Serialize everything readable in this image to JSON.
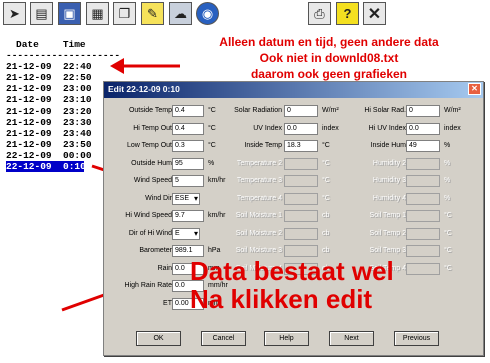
{
  "toolbar": {
    "left_icons": [
      "cursor-icon",
      "chart-icon",
      "image-icon",
      "grid-icon",
      "window-icon",
      "notes-icon",
      "cloud-icon",
      "noaa-icon"
    ],
    "right_icons": [
      "print-icon",
      "help-icon",
      "close-icon"
    ]
  },
  "list": {
    "col_date": "Date",
    "col_time": "Time",
    "separator": "--------------------",
    "rows": [
      "21-12-09  22:40",
      "21-12-09  22:50",
      "21-12-09  23:00",
      "21-12-09  23:10",
      "21-12-09  23:20",
      "21-12-09  23:30",
      "21-12-09  23:40",
      "21-12-09  23:50",
      "22-12-09  00:00",
      "22-12-09  0:10"
    ]
  },
  "annotation_top": {
    "line1": "Alleen datum en tijd, geen andere data",
    "line2": "Ook niet in downld08.txt",
    "line3": "daarom ook geen grafieken"
  },
  "annotation_bottom": {
    "line1": "Data bestaat wel",
    "line2": "Na klikken edit"
  },
  "dialog": {
    "title": "Edit 22-12-09  0:10",
    "col1": [
      {
        "label": "Outside Temp",
        "value": "0.4",
        "unit": "°C"
      },
      {
        "label": "Hi Temp Out",
        "value": "0.4",
        "unit": "°C"
      },
      {
        "label": "Low Temp Out",
        "value": "0.3",
        "unit": "°C"
      },
      {
        "label": "Outside Hum",
        "value": "95",
        "unit": "%"
      },
      {
        "label": "Wind Speed",
        "value": "5",
        "unit": "km/hr"
      },
      {
        "label": "Wind Dir",
        "value": "ESE",
        "unit": ""
      },
      {
        "label": "Hi Wind Speed",
        "value": "9.7",
        "unit": "km/hr"
      },
      {
        "label": "Dir of Hi Wind",
        "value": "E",
        "unit": ""
      },
      {
        "label": "Barometer",
        "value": "989.1",
        "unit": "hPa"
      },
      {
        "label": "Rain",
        "value": "0.0",
        "unit": "mm"
      },
      {
        "label": "High Rain Rate",
        "value": "0.0",
        "unit": "mm/hr"
      },
      {
        "label": "ET",
        "value": "0.00",
        "unit": "mm"
      }
    ],
    "col2": [
      {
        "label": "Solar Radiation",
        "value": "0",
        "unit": "W/m²"
      },
      {
        "label": "UV Index",
        "value": "0.0",
        "unit": "index"
      },
      {
        "label": "Inside Temp",
        "value": "18.3",
        "unit": "°C"
      },
      {
        "label": "Temperature 2",
        "value": "",
        "unit": "°C"
      },
      {
        "label": "Temperature 3",
        "value": "",
        "unit": "°C"
      },
      {
        "label": "Temperature 4",
        "value": "",
        "unit": "°C"
      },
      {
        "label": "Soil Moisture 1",
        "value": "",
        "unit": "cb"
      },
      {
        "label": "Soil Moisture 2",
        "value": "",
        "unit": "cb"
      },
      {
        "label": "Soil Moisture 3",
        "value": "",
        "unit": "cb"
      },
      {
        "label": "Soil Moisture 4",
        "value": "",
        "unit": "cb"
      }
    ],
    "col3": [
      {
        "label": "Hi Solar Rad.",
        "value": "0",
        "unit": "W/m²"
      },
      {
        "label": "Hi UV Index",
        "value": "0.0",
        "unit": "index"
      },
      {
        "label": "Inside Hum",
        "value": "49",
        "unit": "%"
      },
      {
        "label": "Humidity 2",
        "value": "",
        "unit": "%"
      },
      {
        "label": "Humidity 3",
        "value": "",
        "unit": "%"
      },
      {
        "label": "Humidity 4",
        "value": "",
        "unit": "%"
      },
      {
        "label": "Soil Temp 1",
        "value": "",
        "unit": "°C"
      },
      {
        "label": "Soil Temp 2",
        "value": "",
        "unit": "°C"
      },
      {
        "label": "Soil Temp 3",
        "value": "",
        "unit": "°C"
      },
      {
        "label": "Soil Temp 4",
        "value": "",
        "unit": "°C"
      }
    ],
    "buttons": [
      "OK",
      "Cancel",
      "Help",
      "Next",
      "Previous"
    ]
  }
}
